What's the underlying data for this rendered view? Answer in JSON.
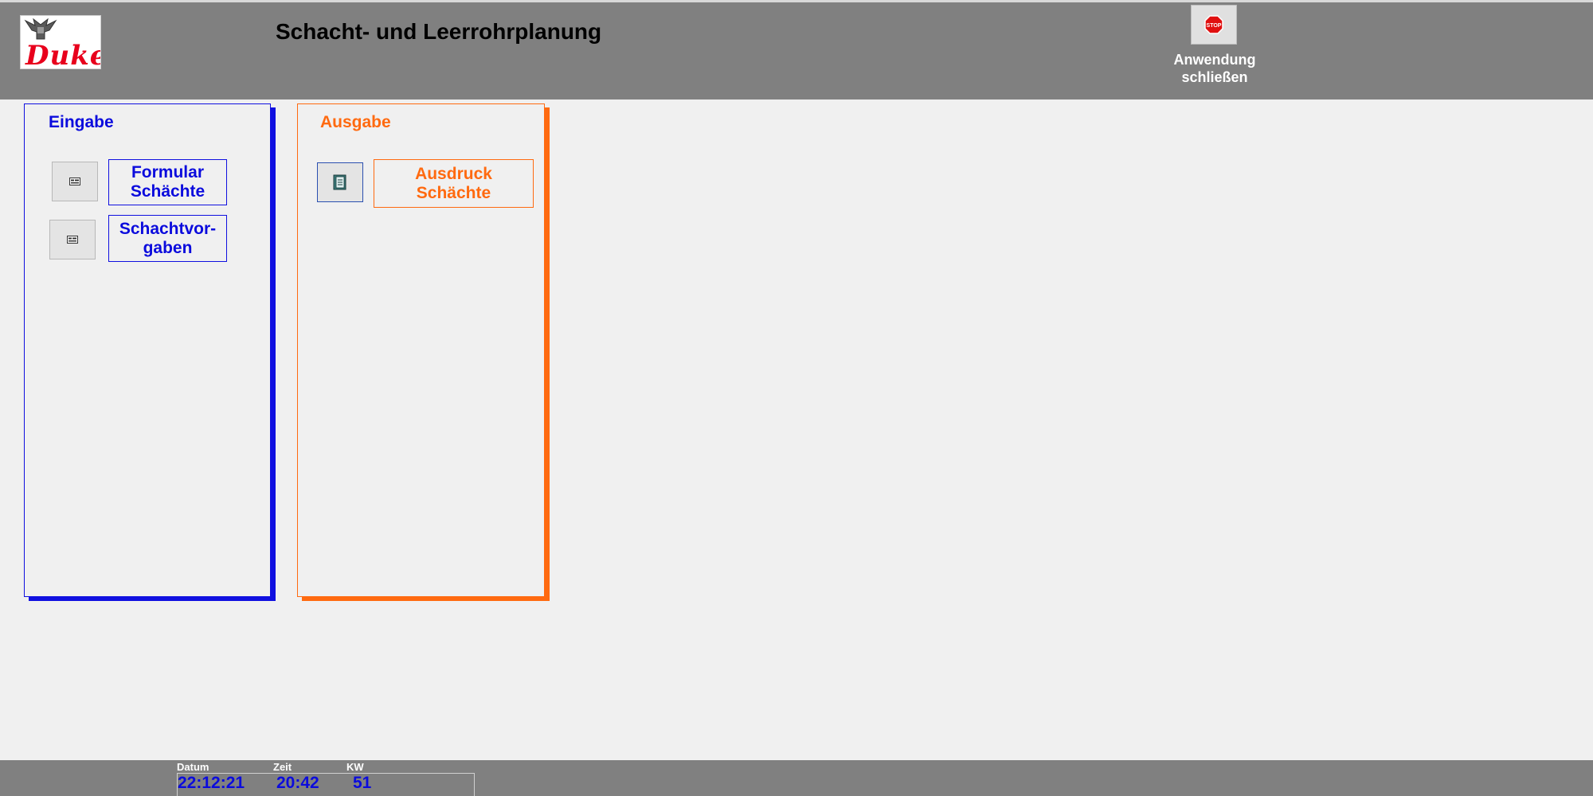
{
  "app": {
    "logo_text": "Duke",
    "title": "Schacht- und Leerrohrplanung"
  },
  "close_button": {
    "icon_text": "STOP",
    "label_line1": "Anwendung",
    "label_line2": "schließen"
  },
  "eingabe": {
    "title": "Eingabe",
    "items": [
      {
        "label_line1": "Formular",
        "label_line2": "Schächte"
      },
      {
        "label_line1": "Schachtvor-",
        "label_line2": "gaben"
      }
    ]
  },
  "ausgabe": {
    "title": "Ausgabe",
    "items": [
      {
        "label_line1": "Ausdruck",
        "label_line2": "Schächte"
      }
    ]
  },
  "footer": {
    "datum_label": "Datum",
    "zeit_label": "Zeit",
    "kw_label": "KW",
    "datum_value": "22:12:21",
    "zeit_value": "20:42",
    "kw_value": "51"
  },
  "colors": {
    "header_bg": "#808080",
    "eingabe_accent": "#1010e0",
    "ausgabe_accent": "#ff6a10",
    "value_blue": "#0b0bdd"
  }
}
